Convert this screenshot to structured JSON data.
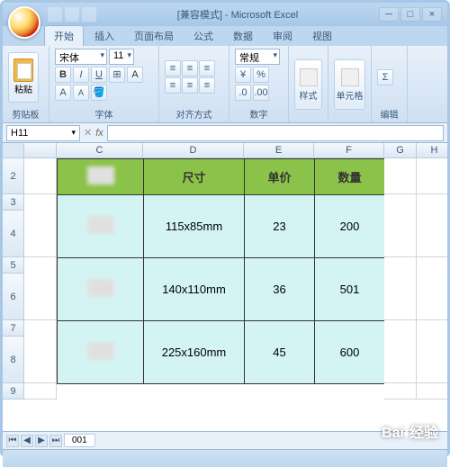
{
  "window": {
    "title": "[兼容模式] - Microsoft Excel",
    "minimize": "─",
    "maximize": "□",
    "close": "×"
  },
  "ribbon": {
    "tabs": [
      "开始",
      "插入",
      "页面布局",
      "公式",
      "数据",
      "审阅",
      "视图"
    ],
    "active_tab": 0,
    "groups": {
      "clipboard": {
        "label": "剪贴板",
        "paste": "粘贴"
      },
      "font": {
        "label": "字体",
        "font_name": "宋体",
        "font_size": "11",
        "bold": "B",
        "italic": "I",
        "underline": "U"
      },
      "alignment": {
        "label": "对齐方式"
      },
      "number": {
        "label": "数字",
        "format": "常规"
      },
      "styles": {
        "label": "样式",
        "btn": "样式"
      },
      "cells": {
        "label": "单元格",
        "btn": "单元格"
      },
      "edit": {
        "label": "编辑"
      }
    }
  },
  "formula_bar": {
    "name_box": "H11",
    "fx": "fx",
    "value": ""
  },
  "sheet": {
    "columns": [
      "C",
      "D",
      "E",
      "F",
      "G",
      "H"
    ],
    "rows": [
      "2",
      "3",
      "4",
      "5",
      "6",
      "7",
      "8",
      "9"
    ],
    "headers": [
      "",
      "尺寸",
      "单价",
      "数量"
    ],
    "data": [
      [
        "",
        "115x85mm",
        "23",
        "200"
      ],
      [
        "",
        "140x110mm",
        "36",
        "501"
      ],
      [
        "",
        "225x160mm",
        "45",
        "600"
      ]
    ]
  },
  "tabs": {
    "sheet_name": "001",
    "nav": [
      "⏮",
      "◀",
      "▶",
      "⏭"
    ]
  },
  "watermark": "Bai 经验"
}
